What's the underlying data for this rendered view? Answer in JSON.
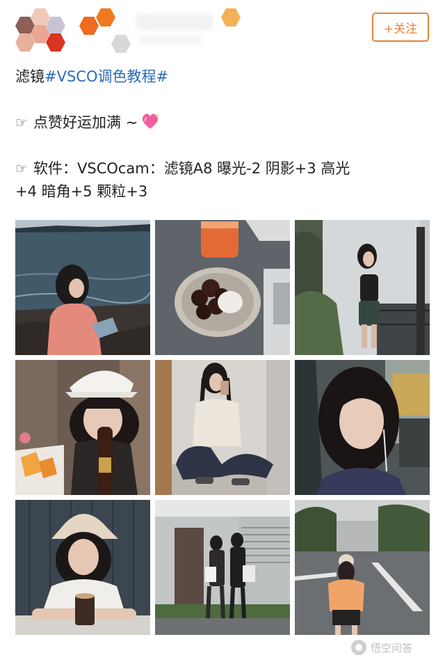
{
  "header": {
    "follow_label": "+关注",
    "colors": {
      "accent": "#e8833a",
      "hashtag": "#2d6bb5"
    }
  },
  "post": {
    "line1_prefix": "滤镜",
    "hashtag": "#VSCO调色教程#",
    "line2_text": "点赞好运加满 ~",
    "line3_text": "软件：VSCOcam：滤镜A8  曝光-2  阴影+3  高光",
    "line4_text": "+4  暗角+5  颗粒+3",
    "icons": [
      "pointing-hand-icon",
      "sparkling-heart-icon"
    ]
  },
  "watermark": {
    "label": "悟空问答"
  }
}
